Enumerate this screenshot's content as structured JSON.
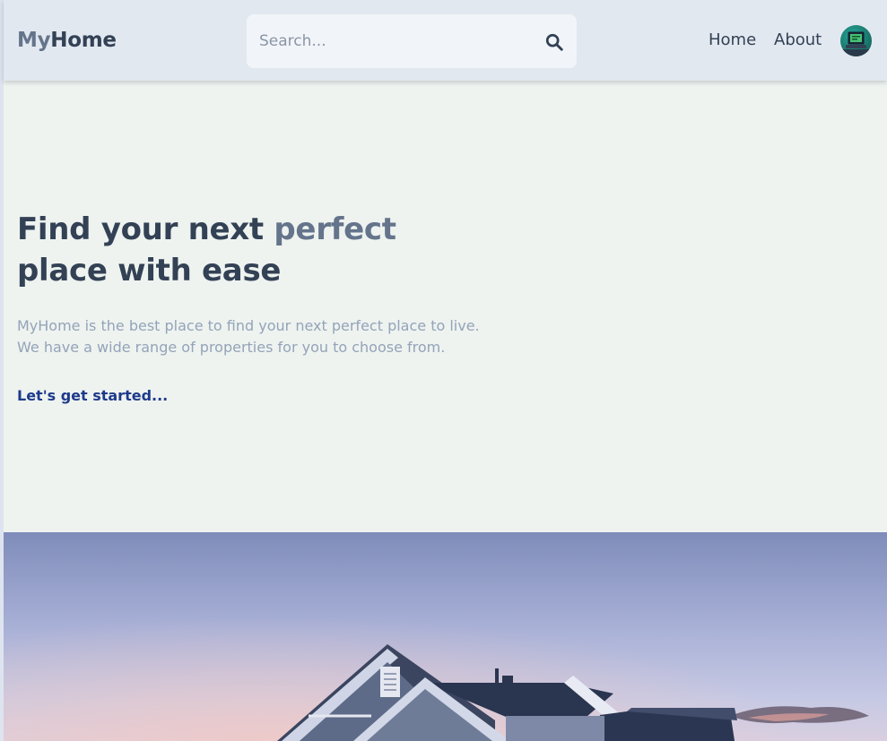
{
  "header": {
    "logo_prefix": "My",
    "logo_suffix": "Home",
    "search_placeholder": "Search...",
    "search_icon": "search-icon",
    "nav": [
      {
        "label": "Home"
      },
      {
        "label": "About"
      }
    ],
    "avatar_icon": "user-avatar"
  },
  "hero": {
    "title_part1": "Find your next ",
    "title_accent": "perfect",
    "title_part2": "place with ease",
    "description_line1": "MyHome is the best place to find your next perfect place to live.",
    "description_line2": "We have a wide range of properties for you to choose from.",
    "cta_label": "Let's get started..."
  },
  "colors": {
    "header_bg": "#e2e8f0",
    "page_bg": "#eef3f0",
    "text_dark": "#334155",
    "accent": "#64748b",
    "muted": "#94a3b8",
    "cta": "#1e3a8a"
  }
}
